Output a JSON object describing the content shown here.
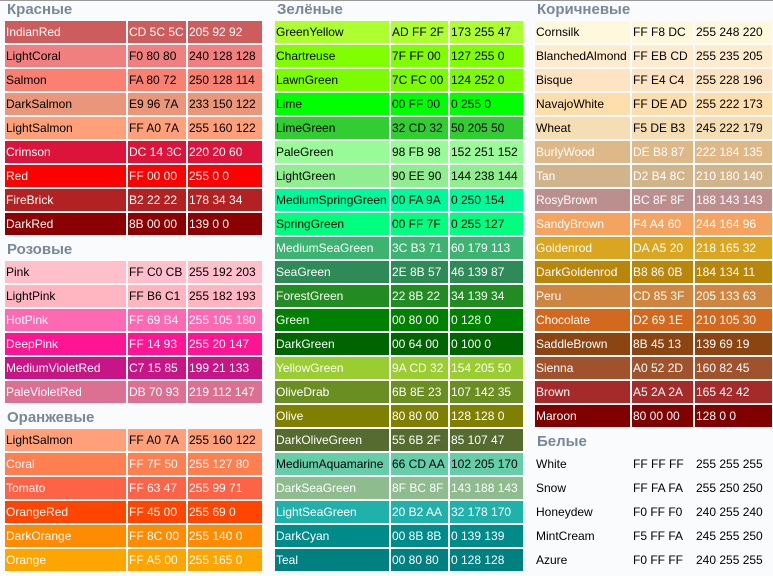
{
  "columns": [
    {
      "groups": [
        {
          "title": "Красные",
          "rows": [
            [
              "IndianRed",
              "CD 5C 5C",
              "205 92 92",
              "#fff"
            ],
            [
              "LightCoral",
              "F0 80 80",
              "240 128 128",
              "#000"
            ],
            [
              "Salmon",
              "FA 80 72",
              "250 128 114",
              "#000"
            ],
            [
              "DarkSalmon",
              "E9 96 7A",
              "233 150 122",
              "#000"
            ],
            [
              "LightSalmon",
              "FF A0 7A",
              "255 160 122",
              "#000"
            ],
            [
              "Crimson",
              "DC 14 3C",
              "220 20 60",
              "#fff"
            ],
            [
              "Red",
              "FF 00 00",
              "255 0 0",
              "#fff"
            ],
            [
              "FireBrick",
              "B2 22 22",
              "178 34 34",
              "#fff"
            ],
            [
              "DarkRed",
              "8B 00 00",
              "139 0 0",
              "#fff"
            ]
          ]
        },
        {
          "title": "Розовые",
          "rows": [
            [
              "Pink",
              "FF C0 CB",
              "255 192 203",
              "#000"
            ],
            [
              "LightPink",
              "FF B6 C1",
              "255 182 193",
              "#000"
            ],
            [
              "HotPink",
              "FF 69 B4",
              "255 105 180",
              "#fff"
            ],
            [
              "DeepPink",
              "FF 14 93",
              "255 20 147",
              "#fff"
            ],
            [
              "MediumVioletRed",
              "C7 15 85",
              "199 21 133",
              "#fff"
            ],
            [
              "PaleVioletRed",
              "DB 70 93",
              "219 112 147",
              "#fff"
            ]
          ]
        },
        {
          "title": "Оранжевые",
          "rows": [
            [
              "LightSalmon",
              "FF A0 7A",
              "255 160 122",
              "#000"
            ],
            [
              "Coral",
              "FF 7F 50",
              "255 127 80",
              "#fff"
            ],
            [
              "Tomato",
              "FF 63 47",
              "255 99 71",
              "#fff"
            ],
            [
              "OrangeRed",
              "FF 45 00",
              "255 69 0",
              "#fff"
            ],
            [
              "DarkOrange",
              "FF 8C 00",
              "255 140 0",
              "#fff"
            ],
            [
              "Orange",
              "FF A5 00",
              "255 165 0",
              "#fff"
            ]
          ]
        }
      ]
    },
    {
      "groups": [
        {
          "title": "Зелёные",
          "rows": [
            [
              "GreenYellow",
              "AD FF 2F",
              "173 255 47",
              "#000"
            ],
            [
              "Chartreuse",
              "7F FF 00",
              "127 255 0",
              "#000"
            ],
            [
              "LawnGreen",
              "7C FC 00",
              "124 252 0",
              "#000"
            ],
            [
              "Lime",
              "00 FF 00",
              "0 255 0",
              "#000"
            ],
            [
              "LimeGreen",
              "32 CD 32",
              "50 205 50",
              "#000"
            ],
            [
              "PaleGreen",
              "98 FB 98",
              "152 251 152",
              "#000"
            ],
            [
              "LightGreen",
              "90 EE 90",
              "144 238 144",
              "#000"
            ],
            [
              "MediumSpringGreen",
              "00 FA 9A",
              "0 250 154",
              "#000"
            ],
            [
              "SpringGreen",
              "00 FF 7F",
              "0 255 127",
              "#000"
            ],
            [
              "MediumSeaGreen",
              "3C B3 71",
              "60 179 113",
              "#fff"
            ],
            [
              "SeaGreen",
              "2E 8B 57",
              "46 139 87",
              "#fff"
            ],
            [
              "ForestGreen",
              "22 8B 22",
              "34 139 34",
              "#fff"
            ],
            [
              "Green",
              "00 80 00",
              "0 128 0",
              "#fff"
            ],
            [
              "DarkGreen",
              "00 64 00",
              "0 100 0",
              "#fff"
            ],
            [
              "YellowGreen",
              "9A CD 32",
              "154 205 50",
              "#fff"
            ],
            [
              "OliveDrab",
              "6B 8E 23",
              "107 142 35",
              "#fff"
            ],
            [
              "Olive",
              "80 80 00",
              "128 128 0",
              "#fff"
            ],
            [
              "DarkOliveGreen",
              "55 6B 2F",
              "85 107 47",
              "#fff"
            ],
            [
              "MediumAquamarine",
              "66 CD AA",
              "102 205 170",
              "#000"
            ],
            [
              "DarkSeaGreen",
              "8F BC 8F",
              "143 188 143",
              "#fff"
            ],
            [
              "LightSeaGreen",
              "20 B2 AA",
              "32 178 170",
              "#fff"
            ],
            [
              "DarkCyan",
              "00 8B 8B",
              "0 139 139",
              "#fff"
            ],
            [
              "Teal",
              "00 80 80",
              "0 128 128",
              "#fff"
            ]
          ]
        }
      ]
    },
    {
      "groups": [
        {
          "title": "Коричневые",
          "rows": [
            [
              "Cornsilk",
              "FF F8 DC",
              "255 248 220",
              "#000"
            ],
            [
              "BlanchedAlmond",
              "FF EB CD",
              "255 235 205",
              "#000"
            ],
            [
              "Bisque",
              "FF E4 C4",
              "255 228 196",
              "#000"
            ],
            [
              "NavajoWhite",
              "FF DE AD",
              "255 222 173",
              "#000"
            ],
            [
              "Wheat",
              "F5 DE B3",
              "245 222 179",
              "#000"
            ],
            [
              "BurlyWood",
              "DE B8 87",
              "222 184 135",
              "#fff"
            ],
            [
              "Tan",
              "D2 B4 8C",
              "210 180 140",
              "#fff"
            ],
            [
              "RosyBrown",
              "BC 8F 8F",
              "188 143 143",
              "#fff"
            ],
            [
              "SandyBrown",
              "F4 A4 60",
              "244 164 96",
              "#fff"
            ],
            [
              "Goldenrod",
              "DA A5 20",
              "218 165 32",
              "#fff"
            ],
            [
              "DarkGoldenrod",
              "B8 86 0B",
              "184 134 11",
              "#fff"
            ],
            [
              "Peru",
              "CD 85 3F",
              "205 133 63",
              "#fff"
            ],
            [
              "Chocolate",
              "D2 69 1E",
              "210 105 30",
              "#fff"
            ],
            [
              "SaddleBrown",
              "8B 45 13",
              "139 69 19",
              "#fff"
            ],
            [
              "Sienna",
              "A0 52 2D",
              "160 82 45",
              "#fff"
            ],
            [
              "Brown",
              "A5 2A 2A",
              "165 42 42",
              "#fff"
            ],
            [
              "Maroon",
              "80 00 00",
              "128 0 0",
              "#fff"
            ]
          ]
        },
        {
          "title": "Белые",
          "rows": [
            [
              "White",
              "FF FF FF",
              "255 255 255",
              "#000"
            ],
            [
              "Snow",
              "FF FA FA",
              "255 250 250",
              "#000"
            ],
            [
              "Honeydew",
              "F0 FF F0",
              "240 255 240",
              "#000"
            ],
            [
              "MintCream",
              "F5 FF FA",
              "245 255 250",
              "#000"
            ],
            [
              "Azure",
              "F0 FF FF",
              "240 255 255",
              "#000"
            ]
          ],
          "transparent_background": true
        }
      ]
    }
  ]
}
